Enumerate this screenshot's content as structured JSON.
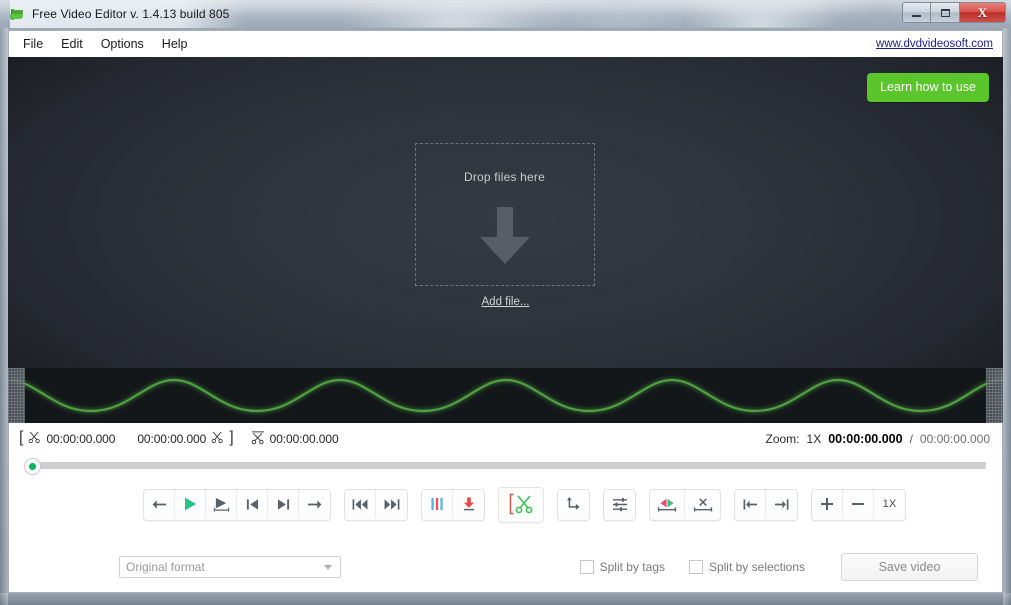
{
  "window": {
    "title": "Free Video Editor v. 1.4.13 build 805",
    "app_icon": "video-editor-icon",
    "buttons": {
      "minimize": "minimize-icon",
      "maximize": "maximize-icon",
      "close": "X"
    }
  },
  "menubar": {
    "items": [
      {
        "label": "File"
      },
      {
        "label": "Edit"
      },
      {
        "label": "Options"
      },
      {
        "label": "Help"
      }
    ],
    "site_link": "www.dvdvideosoft.com"
  },
  "video_panel": {
    "learn_button": "Learn how to use",
    "dropzone_label": "Drop files here",
    "dropzone_icon": "down-arrow-icon",
    "add_file_link": "Add file..."
  },
  "waveform": {
    "handle_left": "left-trim-handle",
    "handle_right": "right-trim-handle",
    "wave_color": "#4fa03f"
  },
  "timecode": {
    "cut_start_icon": "scissors-icon",
    "cut_start": "00:00:00.000",
    "cut_end": "00:00:00.000",
    "cut_end_icon": "scissors-icon",
    "marker_icon": "scissors-marker-icon",
    "marker_value": "00:00:00.000"
  },
  "zoom_info": {
    "zoom_label": "Zoom:",
    "zoom_value": "1X",
    "current_time": "00:00:00.000",
    "separator": "/",
    "total_time": "00:00:00.000"
  },
  "seek": {
    "position_percent": 0,
    "thumb_color": "#00b45c"
  },
  "toolbar": {
    "groups": [
      {
        "name": "playback",
        "buttons": [
          {
            "name": "step-back-button",
            "icon": "arrow-left-icon"
          },
          {
            "name": "play-button",
            "icon": "play-icon"
          },
          {
            "name": "play-selection-button",
            "icon": "play-range-icon"
          },
          {
            "name": "jump-prev-marker-button",
            "icon": "skip-to-start-icon"
          },
          {
            "name": "jump-next-marker-button",
            "icon": "skip-to-end-icon"
          },
          {
            "name": "step-forward-button",
            "icon": "arrow-right-icon"
          }
        ]
      },
      {
        "name": "navigation",
        "buttons": [
          {
            "name": "rewind-button",
            "icon": "rewind-icon"
          },
          {
            "name": "fast-forward-button",
            "icon": "fast-forward-icon"
          }
        ]
      },
      {
        "name": "markers",
        "buttons": [
          {
            "name": "add-tags-button",
            "icon": "color-bars-icon"
          },
          {
            "name": "insert-marker-button",
            "icon": "down-insert-icon"
          }
        ]
      },
      {
        "name": "cut",
        "buttons": [
          {
            "name": "cut-button",
            "icon": "scissors-bracket-icon"
          }
        ]
      },
      {
        "name": "rotate",
        "buttons": [
          {
            "name": "rotate-button",
            "icon": "rotate-arrow-icon"
          }
        ]
      },
      {
        "name": "settings",
        "buttons": [
          {
            "name": "adjust-settings-button",
            "icon": "sliders-icon"
          }
        ]
      },
      {
        "name": "selection",
        "buttons": [
          {
            "name": "invert-selection-button",
            "icon": "invert-range-icon"
          },
          {
            "name": "delete-selection-button",
            "icon": "delete-range-icon"
          }
        ]
      },
      {
        "name": "edges",
        "buttons": [
          {
            "name": "go-to-start-button",
            "icon": "snap-left-icon"
          },
          {
            "name": "go-to-end-button",
            "icon": "snap-right-icon"
          }
        ]
      },
      {
        "name": "zoom",
        "buttons": [
          {
            "name": "zoom-in-button",
            "icon": "plus-icon"
          },
          {
            "name": "zoom-out-button",
            "icon": "minus-icon"
          },
          {
            "name": "zoom-reset-button",
            "label": "1X"
          }
        ]
      }
    ]
  },
  "bottom_bar": {
    "format_selected": "Original format",
    "split_by_tags": {
      "label": "Split by tags",
      "checked": false
    },
    "split_by_selections": {
      "label": "Split by selections",
      "checked": false
    },
    "save_button": "Save video"
  },
  "colors": {
    "accent_green": "#5bc62c",
    "play_green": "#2dbf8a",
    "panel_dark": "#2e323c",
    "wave_green": "#4fa03f",
    "close_red": "#b92f28"
  }
}
